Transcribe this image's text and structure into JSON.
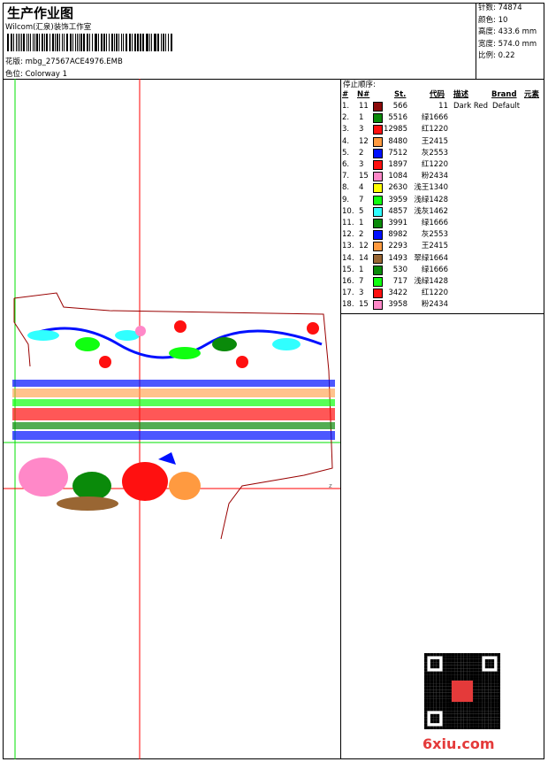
{
  "header": {
    "title": "生产作业图",
    "company": "Wilcom(汇泉)装饰工作室",
    "design_label": "花版:",
    "design_value": "mbg_27567ACE4976.EMB",
    "colorway_label": "色位:",
    "colorway_value": "Colorway 1"
  },
  "info": [
    {
      "label": "针数:",
      "value": "74874"
    },
    {
      "label": "颜色:",
      "value": "10"
    },
    {
      "label": "高度:",
      "value": "433.6 mm"
    },
    {
      "label": "宽度:",
      "value": "574.0 mm"
    },
    {
      "label": "比例:",
      "value": "0.22"
    }
  ],
  "table": {
    "title": "停止顺序:",
    "headers": {
      "num": "#",
      "n": "N#",
      "st": "St.",
      "code": "代码",
      "desc": "描述",
      "brand": "Brand",
      "elem": "元素"
    },
    "rows": [
      {
        "i": "1.",
        "n": "11",
        "color": "#8b0a0a",
        "st": "566",
        "code": "11",
        "desc": "Dark Red",
        "brand": "Default"
      },
      {
        "i": "2.",
        "n": "1",
        "color": "#0a8a0a",
        "st": "5516",
        "code": "绿1666"
      },
      {
        "i": "3.",
        "n": "3",
        "color": "#ff1010",
        "st": "12985",
        "code": "红1220"
      },
      {
        "i": "4.",
        "n": "12",
        "color": "#ff9a40",
        "st": "8480",
        "code": "王2415"
      },
      {
        "i": "5.",
        "n": "2",
        "color": "#0010ff",
        "st": "7512",
        "code": "灰2553"
      },
      {
        "i": "6.",
        "n": "3",
        "color": "#ff1010",
        "st": "1897",
        "code": "红1220"
      },
      {
        "i": "7.",
        "n": "15",
        "color": "#ff88c8",
        "st": "1084",
        "code": "粉2434"
      },
      {
        "i": "8.",
        "n": "4",
        "color": "#ffff00",
        "st": "2630",
        "code": "浅王1340"
      },
      {
        "i": "9.",
        "n": "7",
        "color": "#10ff10",
        "st": "3959",
        "code": "浅绿1428"
      },
      {
        "i": "10.",
        "n": "5",
        "color": "#30ffff",
        "st": "4857",
        "code": "浅灰1462"
      },
      {
        "i": "11.",
        "n": "1",
        "color": "#0a8a0a",
        "st": "3991",
        "code": "绿1666"
      },
      {
        "i": "12.",
        "n": "2",
        "color": "#0010ff",
        "st": "8982",
        "code": "灰2553"
      },
      {
        "i": "13.",
        "n": "12",
        "color": "#ff9a40",
        "st": "2293",
        "code": "王2415"
      },
      {
        "i": "14.",
        "n": "14",
        "color": "#996633",
        "st": "1493",
        "code": "翠绿1664"
      },
      {
        "i": "15.",
        "n": "1",
        "color": "#0a8a0a",
        "st": "530",
        "code": "绿1666"
      },
      {
        "i": "16.",
        "n": "7",
        "color": "#10ff10",
        "st": "717",
        "code": "浅绿1428"
      },
      {
        "i": "17.",
        "n": "3",
        "color": "#ff1010",
        "st": "3422",
        "code": "红1220"
      },
      {
        "i": "18.",
        "n": "15",
        "color": "#ff88c8",
        "st": "3958",
        "code": "粉2434"
      }
    ]
  },
  "watermark": "6xiu.com"
}
